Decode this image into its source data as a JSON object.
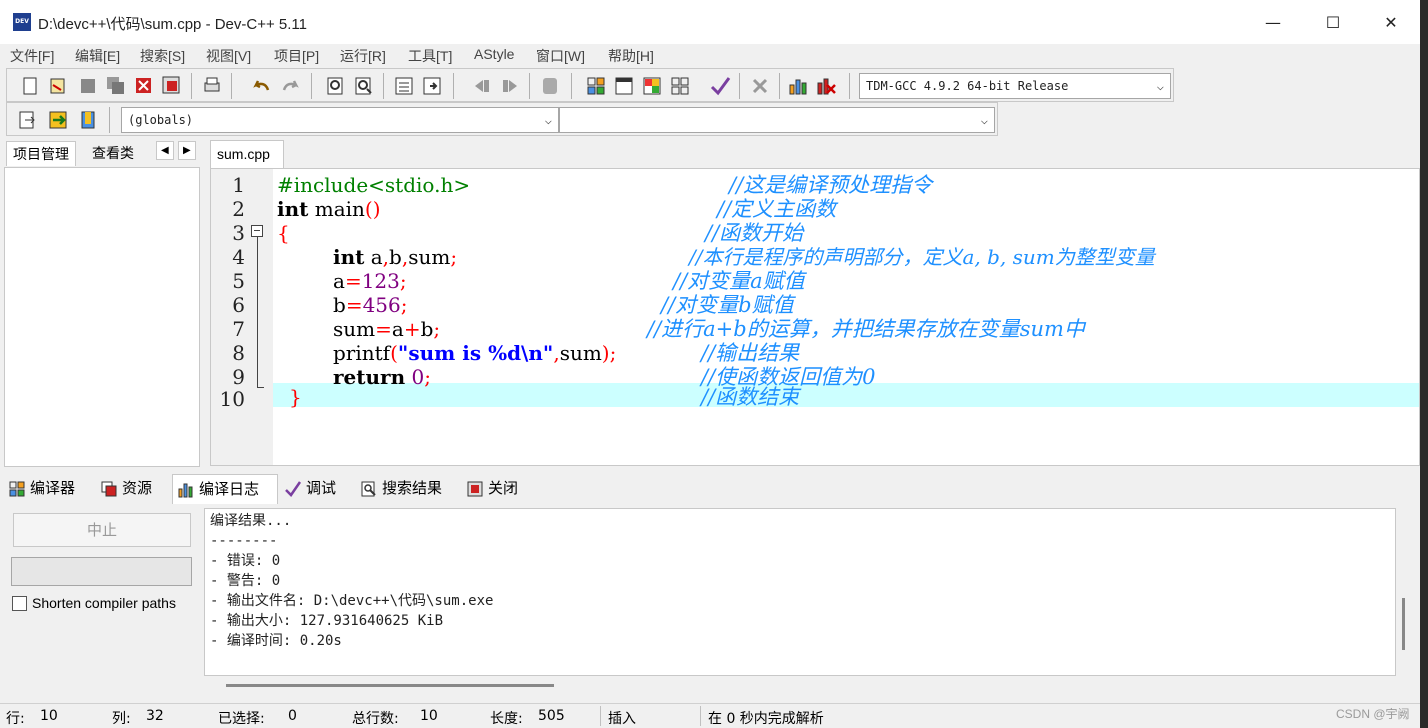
{
  "window": {
    "title": "D:\\devc++\\代码\\sum.cpp - Dev-C++ 5.11",
    "icon_label": "DEV",
    "controls": {
      "minimize": "—",
      "maximize": "☐",
      "close": "✕"
    }
  },
  "menu": [
    "文件[F]",
    "编辑[E]",
    "搜索[S]",
    "视图[V]",
    "项目[P]",
    "运行[R]",
    "工具[T]",
    "AStyle",
    "窗口[W]",
    "帮助[H]"
  ],
  "toolbar": {
    "compiler_select": "TDM-GCC 4.9.2 64-bit Release",
    "class_select": "(globals)",
    "member_select": ""
  },
  "left_tabs": {
    "project": "项目管理",
    "classes": "查看类",
    "prev": "◀",
    "next": "▶"
  },
  "editor": {
    "file_tab": "sum.cpp",
    "line_numbers": [
      "1",
      "2",
      "3",
      "4",
      "5",
      "6",
      "7",
      "8",
      "9",
      "10"
    ],
    "code": {
      "l1": "#include<stdio.h>",
      "l2_kw": "int",
      "l2_rest": " main",
      "l2_paren": "()",
      "l3": "{",
      "l4_kw": "int",
      "l4_vars": " a",
      "l4_c1": ",",
      "l4_b": "b",
      "l4_c2": ",",
      "l4_sum": "sum",
      "l4_semi": ";",
      "l5_var": "a",
      "l5_eq": "=",
      "l5_num": "123",
      "l5_semi": ";",
      "l6_var": "b",
      "l6_eq": "=",
      "l6_num": "456",
      "l6_semi": ";",
      "l7_var": "sum",
      "l7_eq": "=",
      "l7_a": "a",
      "l7_plus": "+",
      "l7_b": "b",
      "l7_semi": ";",
      "l8_fn": "printf",
      "l8_open": "(",
      "l8_str": "\"sum is %d\\n\"",
      "l8_comma": ",",
      "l8_arg": "sum",
      "l8_close": ")",
      "l8_semi": ";",
      "l9_kw": "return",
      "l9_num": "0",
      "l9_semi": ";",
      "l10": "}"
    },
    "comments": [
      "//这是编译预处理指令",
      "//定义主函数",
      "//函数开始",
      "//本行是程序的声明部分，定义a, b, sum为整型变量",
      "//对变量a赋值",
      "//对变量b赋值",
      "//进行a+b的运算，并把结果存放在变量sum中",
      "//输出结果",
      "//使函数返回值为0",
      "//函数结束"
    ]
  },
  "bottom_tabs": [
    "编译器",
    "资源",
    "编译日志",
    "调试",
    "搜索结果",
    "关闭"
  ],
  "compile_panel": {
    "stop_button": "中止",
    "shorten_label": "Shorten compiler paths",
    "log": [
      "编译结果...",
      "--------",
      "- 错误: 0",
      "- 警告: 0",
      "- 输出文件名: D:\\devc++\\代码\\sum.exe",
      "- 输出大小: 127.931640625 KiB",
      "- 编译时间: 0.20s"
    ]
  },
  "status": {
    "row_label": "行:",
    "row": "10",
    "col_label": "列:",
    "col": "32",
    "sel_label": "已选择:",
    "sel": "0",
    "lines_label": "总行数:",
    "lines": "10",
    "len_label": "长度:",
    "len": "505",
    "mode": "插入",
    "parse": "在 0 秒内完成解析"
  },
  "watermark": "CSDN @宇阙",
  "colors": {
    "comment": "#1e90ff",
    "preprocessor": "#008000",
    "symbol": "#ff0000",
    "number": "#800080",
    "string": "#0000ff",
    "current_line": "#ccffff"
  }
}
